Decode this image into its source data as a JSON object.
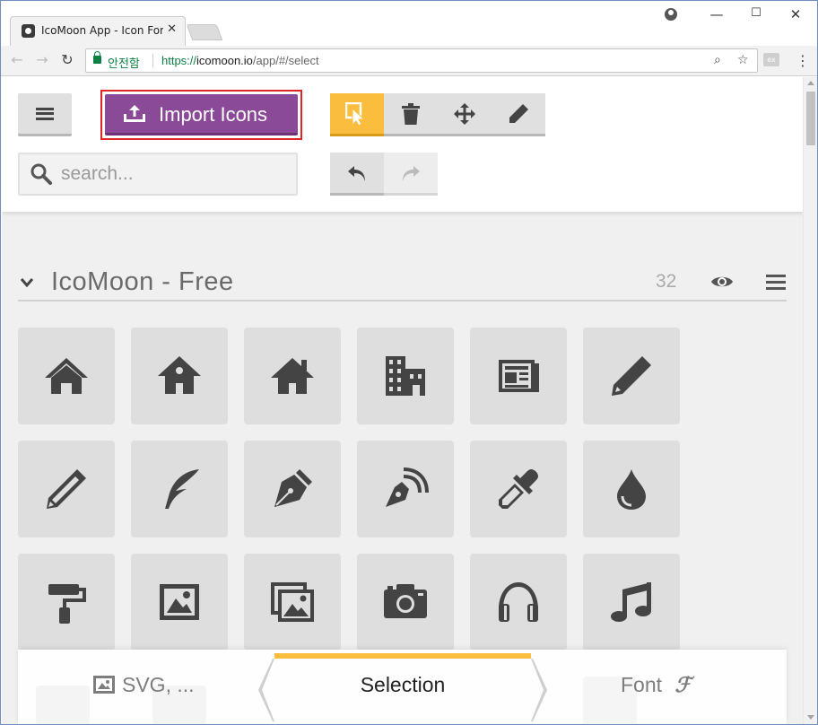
{
  "browser": {
    "tab_title": "IcoMoon App - Icon Font",
    "tab_close": "✕",
    "secure_label": "안전함",
    "url_scheme": "https://",
    "url_host": "icomoon.io",
    "url_path": "/app/#/select",
    "ext_label": "ex",
    "window_buttons": {
      "minimize": "—",
      "maximize": "☐",
      "close": "✕"
    },
    "nav": {
      "back": "←",
      "forward": "→",
      "reload": "↻"
    },
    "zoom_icon": "⌕",
    "star_icon": "☆",
    "menu": "⋮"
  },
  "app": {
    "import_label": "Import Icons",
    "search_placeholder": "search...",
    "accent_color": "#8b4a98",
    "selection_color": "#fbbd3d",
    "tools": [
      {
        "name": "select-tool",
        "icon": "pointer-icon",
        "active": true
      },
      {
        "name": "delete-tool",
        "icon": "trash-icon",
        "active": false
      },
      {
        "name": "move-tool",
        "icon": "move-icon",
        "active": false
      },
      {
        "name": "edit-tool",
        "icon": "pencil-icon",
        "active": false
      }
    ],
    "set": {
      "title": "IcoMoon - Free",
      "count": "32"
    },
    "glyphs": [
      "home-icon",
      "home2-icon",
      "home3-icon",
      "office-icon",
      "newspaper-icon",
      "pencil-icon",
      "pencil2-icon",
      "quill-icon",
      "pen-icon",
      "blog-icon",
      "eyedropper-icon",
      "droplet-icon",
      "paint-format-icon",
      "image-icon",
      "images-icon",
      "camera-icon",
      "headphones-icon",
      "music-icon"
    ],
    "bottom_bar": {
      "svg_label": "SVG, ...",
      "selection_label": "Selection",
      "font_label": "Font"
    }
  }
}
